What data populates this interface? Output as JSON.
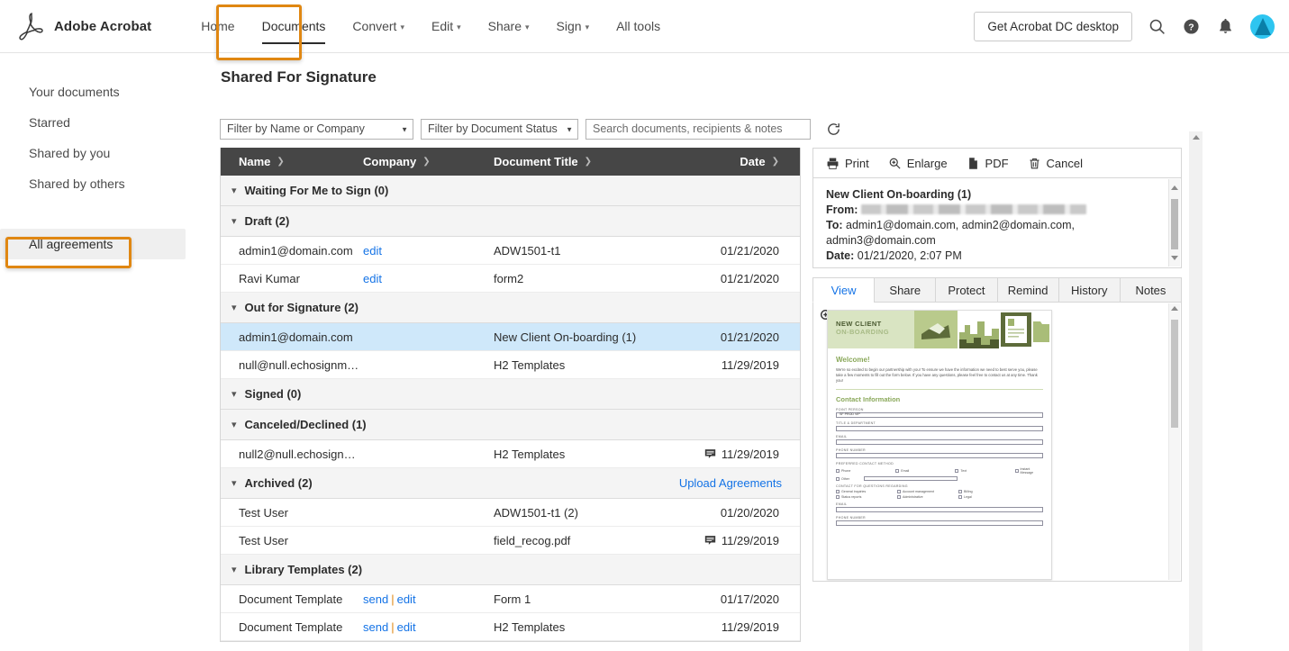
{
  "header": {
    "brand": "Adobe Acrobat",
    "logo_icon": "adobe-acrobat-logo",
    "nav": [
      {
        "label": "Home",
        "caret": false,
        "active": false
      },
      {
        "label": "Documents",
        "caret": false,
        "active": true
      },
      {
        "label": "Convert",
        "caret": true,
        "active": false
      },
      {
        "label": "Edit",
        "caret": true,
        "active": false
      },
      {
        "label": "Share",
        "caret": true,
        "active": false
      },
      {
        "label": "Sign",
        "caret": true,
        "active": false
      },
      {
        "label": "All tools",
        "caret": false,
        "active": false
      }
    ],
    "cta_label": "Get Acrobat DC desktop",
    "icons": [
      "search-icon",
      "help-icon",
      "notification-bell-icon",
      "avatar"
    ]
  },
  "sidebar": {
    "items": [
      {
        "label": "Your documents",
        "selected": false
      },
      {
        "label": "Starred",
        "selected": false
      },
      {
        "label": "Shared by you",
        "selected": false
      },
      {
        "label": "Shared by others",
        "selected": false
      }
    ],
    "all_agreements": {
      "label": "All agreements",
      "selected": true
    }
  },
  "main": {
    "page_title": "Shared For Signature",
    "filters": {
      "name_filter": "Filter by Name or Company",
      "status_filter": "Filter by Document Status",
      "search_placeholder": "Search documents, recipients & notes",
      "refresh_icon": "refresh-icon"
    },
    "table": {
      "columns": [
        "Name",
        "Company",
        "Document Title",
        "Date"
      ],
      "groups": [
        {
          "label": "Waiting For Me to Sign (0)",
          "action": null,
          "rows": []
        },
        {
          "label": "Draft (2)",
          "action": null,
          "rows": [
            {
              "name": "admin1@domain.com",
              "links": [
                "edit"
              ],
              "title": "ADW1501-t1",
              "date": "01/21/2020",
              "comment": false,
              "selected": false
            },
            {
              "name": "Ravi Kumar",
              "links": [
                "edit"
              ],
              "title": "form2",
              "date": "01/21/2020",
              "comment": false,
              "selected": false
            }
          ]
        },
        {
          "label": "Out for Signature (2)",
          "action": null,
          "rows": [
            {
              "name": "admin1@domain.com",
              "links": [],
              "title": "New Client On-boarding (1)",
              "date": "01/21/2020",
              "comment": false,
              "selected": true
            },
            {
              "name": "null@null.echosignmail.c...",
              "links": [],
              "title": "H2 Templates",
              "date": "11/29/2019",
              "comment": false,
              "selected": false
            }
          ]
        },
        {
          "label": "Signed (0)",
          "action": null,
          "rows": []
        },
        {
          "label": "Canceled/Declined (1)",
          "action": null,
          "rows": [
            {
              "name": "null2@null.echosignmail...",
              "links": [],
              "title": "H2 Templates",
              "date": "11/29/2019",
              "comment": true,
              "selected": false
            }
          ]
        },
        {
          "label": "Archived (2)",
          "action": "Upload Agreements",
          "rows": [
            {
              "name": "Test User",
              "links": [],
              "title": "ADW1501-t1 (2)",
              "date": "01/20/2020",
              "comment": false,
              "selected": false
            },
            {
              "name": "Test User",
              "links": [],
              "title": "field_recog.pdf",
              "date": "11/29/2019",
              "comment": true,
              "selected": false
            }
          ]
        },
        {
          "label": "Library Templates (2)",
          "action": null,
          "rows": [
            {
              "name": "Document Template",
              "links": [
                "send",
                "edit"
              ],
              "title": "Form 1",
              "date": "01/17/2020",
              "comment": false,
              "selected": false
            },
            {
              "name": "Document Template",
              "links": [
                "send",
                "edit"
              ],
              "title": "H2 Templates",
              "date": "11/29/2019",
              "comment": false,
              "selected": false
            }
          ]
        }
      ]
    }
  },
  "detail": {
    "actions": [
      {
        "label": "Print",
        "icon": "printer-icon"
      },
      {
        "label": "Enlarge",
        "icon": "magnifier-plus-icon"
      },
      {
        "label": "PDF",
        "icon": "pdf-file-icon"
      },
      {
        "label": "Cancel",
        "icon": "trash-icon"
      }
    ],
    "agreement": {
      "title": "New Client On-boarding (1)",
      "from_label": "From:",
      "from_value": "",
      "to_label": "To:",
      "to_value": "admin1@domain.com, admin2@domain.com, admin3@domain.com",
      "date_label": "Date:",
      "date_value": "01/21/2020, 2:07 PM"
    },
    "tabs": [
      {
        "label": "View",
        "active": true
      },
      {
        "label": "Share",
        "active": false
      },
      {
        "label": "Protect",
        "active": false
      },
      {
        "label": "Remind",
        "active": false
      },
      {
        "label": "History",
        "active": false
      },
      {
        "label": "Notes",
        "active": false
      }
    ],
    "preview": {
      "zoom_icon": "zoom-in-icon",
      "doc_title_line1": "NEW CLIENT",
      "doc_title_line2": "ON-BOARDING",
      "welcome_heading": "Welcome!",
      "welcome_body": "We're so excited to begin our partnership with you! To ensure we have the information we need to best serve you, please take a few moments to fill out the form below. If you have any questions, please feel free to contact us at any time. Thank you!",
      "section_heading": "Contact Information",
      "fields": [
        {
          "label": "POINT PERSON",
          "value": "SF PROD VIP"
        },
        {
          "label": "TITLE & DEPARTMENT",
          "value": ""
        },
        {
          "label": "EMAIL",
          "value": ""
        },
        {
          "label": "PHONE NUMBER",
          "value": ""
        }
      ],
      "contact_method_label": "PREFERRED CONTACT METHOD",
      "contact_methods": [
        "Phone",
        "Email",
        "Text",
        "Instant Message",
        "Other"
      ],
      "questions_label": "CONTACT FOR QUESTIONS REGARDING",
      "questions": [
        "General inquiries",
        "Account management",
        "Billing",
        "Status reports",
        "Administrative",
        "Legal"
      ],
      "tail_fields": [
        {
          "label": "EMAIL",
          "value": ""
        },
        {
          "label": "PHONE NUMBER",
          "value": ""
        }
      ]
    }
  },
  "colors": {
    "annotation": "#e08712",
    "link": "#1473e6",
    "header_bg": "#464646",
    "selected_row": "#cfe8fa",
    "accent_avatar": "#2ec5f0"
  }
}
